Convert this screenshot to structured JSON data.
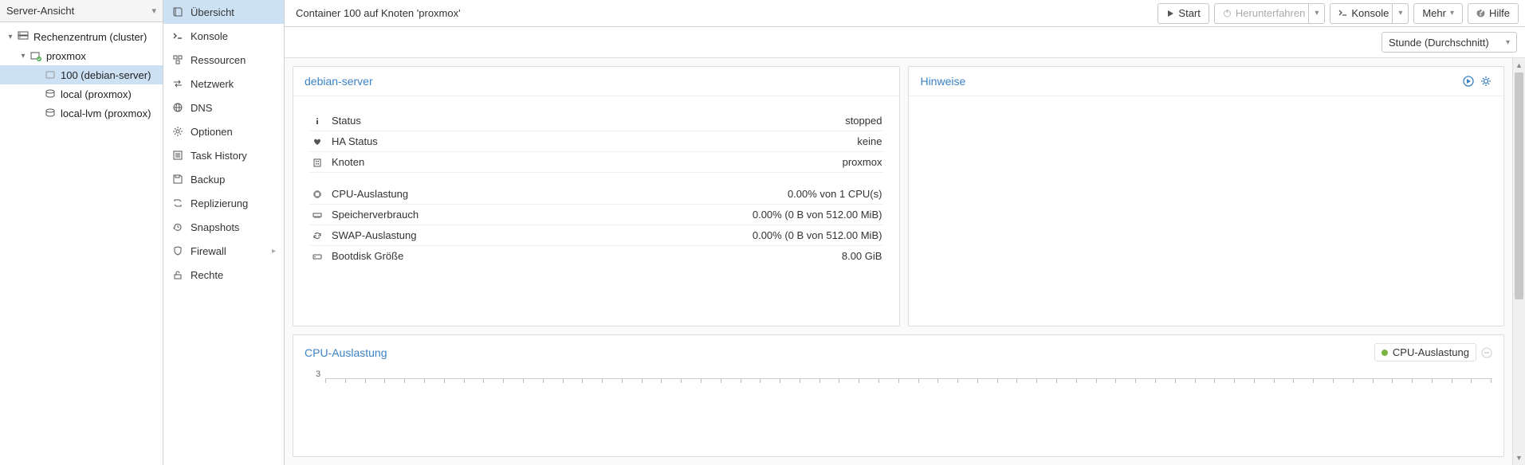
{
  "view_selector": {
    "label": "Server-Ansicht"
  },
  "tree": {
    "root": {
      "label": "Rechenzentrum (cluster)"
    },
    "node": {
      "label": "proxmox"
    },
    "ct": {
      "label": "100 (debian-server)"
    },
    "storage1": {
      "label": "local (proxmox)"
    },
    "storage2": {
      "label": "local-lvm (proxmox)"
    }
  },
  "sidenav": {
    "overview": "Übersicht",
    "console": "Konsole",
    "resources": "Ressourcen",
    "network": "Netzwerk",
    "dns": "DNS",
    "options": "Optionen",
    "taskhistory": "Task History",
    "backup": "Backup",
    "replication": "Replizierung",
    "snapshots": "Snapshots",
    "firewall": "Firewall",
    "permissions": "Rechte"
  },
  "toolbar": {
    "title": "Container 100 auf Knoten 'proxmox'",
    "start": "Start",
    "shutdown": "Herunterfahren",
    "console": "Konsole",
    "more": "Mehr",
    "help": "Hilfe"
  },
  "subbar": {
    "timeframe": "Stunde (Durchschnitt)"
  },
  "panels": {
    "summary_title": "debian-server",
    "notes_title": "Hinweise",
    "stats": {
      "status_label": "Status",
      "status_value": "stopped",
      "ha_label": "HA Status",
      "ha_value": "keine",
      "node_label": "Knoten",
      "node_value": "proxmox",
      "cpu_label": "CPU-Auslastung",
      "cpu_value": "0.00% von 1 CPU(s)",
      "mem_label": "Speicherverbrauch",
      "mem_value": "0.00% (0 B von 512.00 MiB)",
      "swap_label": "SWAP-Auslastung",
      "swap_value": "0.00% (0 B von 512.00 MiB)",
      "disk_label": "Bootdisk Größe",
      "disk_value": "8.00 GiB"
    }
  },
  "chart": {
    "title": "CPU-Auslastung",
    "legend": "CPU-Auslastung",
    "y_tick": "3"
  },
  "chart_data": {
    "type": "line",
    "title": "CPU-Auslastung",
    "series": [
      {
        "name": "CPU-Auslastung",
        "values": []
      }
    ],
    "ylabel": "",
    "ylim": [
      0,
      3
    ]
  }
}
